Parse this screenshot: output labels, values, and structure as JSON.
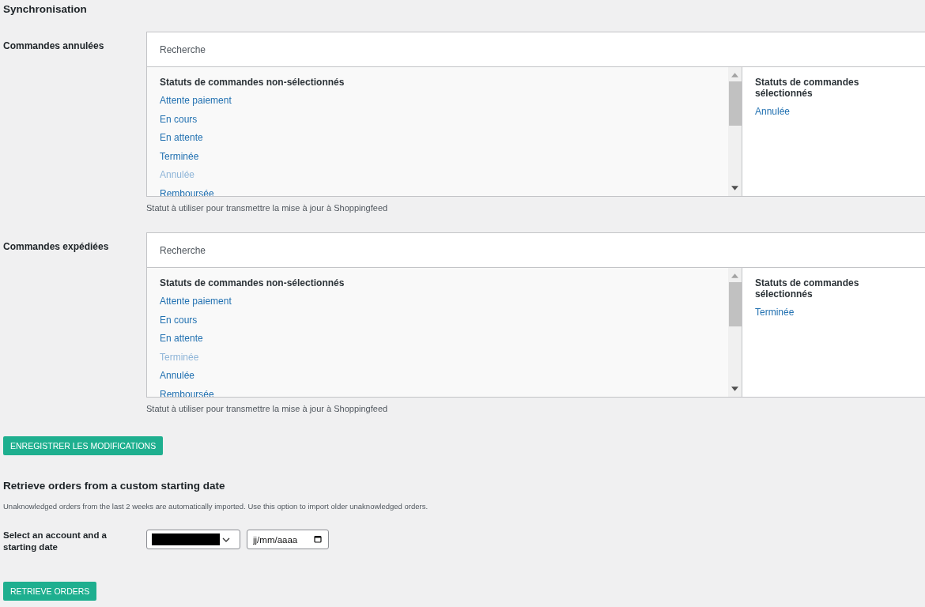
{
  "title": "Synchronisation",
  "sections": [
    {
      "label": "Commandes annulées",
      "search": {
        "placeholder": "Recherche"
      },
      "unselected_heading": "Statuts de commandes non-sélectionnés",
      "unselected": [
        {
          "label": "Attente paiement",
          "disabled": false
        },
        {
          "label": "En cours",
          "disabled": false
        },
        {
          "label": "En attente",
          "disabled": false
        },
        {
          "label": "Terminée",
          "disabled": false
        },
        {
          "label": "Annulée",
          "disabled": true
        },
        {
          "label": "Remboursée",
          "disabled": false
        }
      ],
      "selected_heading": "Statuts de commandes sélectionnés",
      "selected": [
        "Annulée"
      ],
      "hint": "Statut à utiliser pour transmettre la mise à jour à Shoppingfeed"
    },
    {
      "label": "Commandes expédiées",
      "search": {
        "placeholder": "Recherche"
      },
      "unselected_heading": "Statuts de commandes non-sélectionnés",
      "unselected": [
        {
          "label": "Attente paiement",
          "disabled": false
        },
        {
          "label": "En cours",
          "disabled": false
        },
        {
          "label": "En attente",
          "disabled": false
        },
        {
          "label": "Terminée",
          "disabled": true
        },
        {
          "label": "Annulée",
          "disabled": false
        },
        {
          "label": "Remboursée",
          "disabled": false
        }
      ],
      "selected_heading": "Statuts de commandes sélectionnés",
      "selected": [
        "Terminée"
      ],
      "hint": "Statut à utiliser pour transmettre la mise à jour à Shoppingfeed"
    }
  ],
  "save_button": "ENREGISTRER LES MODIFICATIONS",
  "retrieve": {
    "heading": "Retrieve orders from a custom starting date",
    "description": "Unaknowledged orders from the last 2 weeks are automatically imported. Use this option to import older unaknowledged orders.",
    "label": "Select an account and a starting date",
    "account_select": {
      "redacted": true
    },
    "date_field": {
      "placeholder": "jj/mm/aaaa"
    },
    "button": "RETRIEVE ORDERS"
  }
}
